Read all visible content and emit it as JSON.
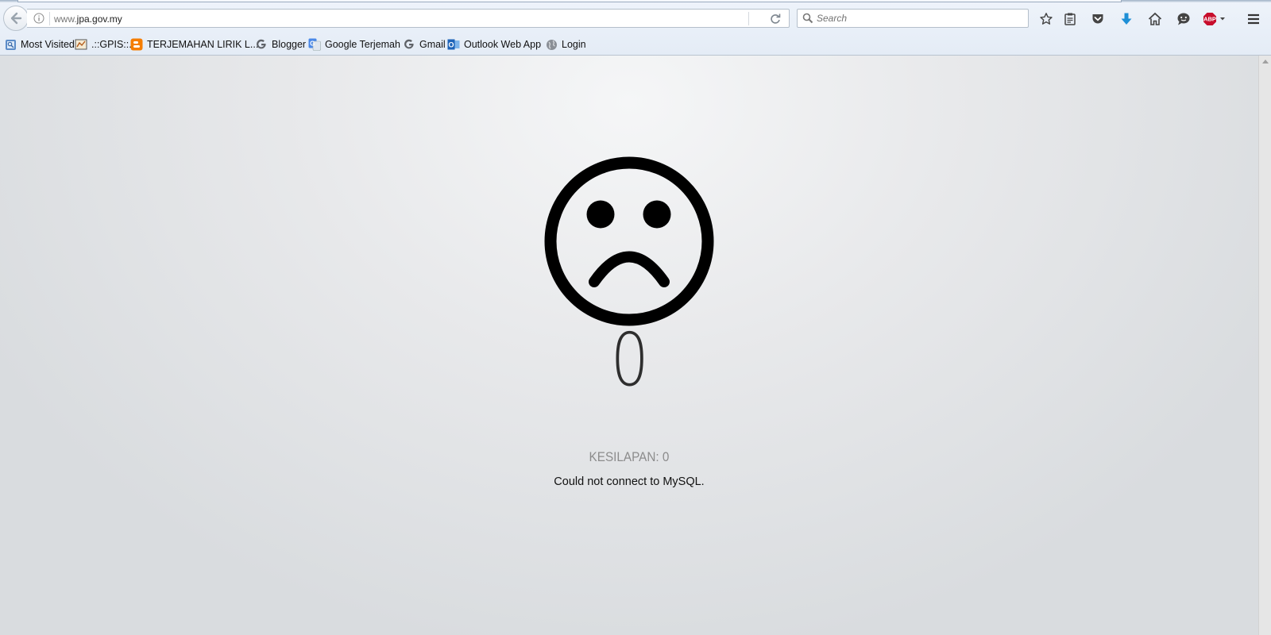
{
  "browser": {
    "url_prefix": "www.",
    "url_domain": "jpa.gov.my",
    "search_placeholder": "Search",
    "bookmarks": [
      {
        "label": "Most Visited",
        "icon": "most-visited-icon"
      },
      {
        "label": ".::GPIS::.",
        "icon": "gpis-favicon"
      },
      {
        "label": "TERJEMAHAN LIRIK L...",
        "icon": "blogger-favicon"
      },
      {
        "label": "Blogger",
        "icon": "google-favicon"
      },
      {
        "label": "Google Terjemah",
        "icon": "google-translate-favicon"
      },
      {
        "label": "Gmail",
        "icon": "google-favicon"
      },
      {
        "label": "Outlook Web App",
        "icon": "outlook-favicon"
      },
      {
        "label": "Login",
        "icon": "globe-favicon"
      }
    ],
    "toolbar_icons": [
      "bookmark-star-icon",
      "reading-list-icon",
      "pocket-icon",
      "download-icon",
      "home-icon",
      "chat-icon",
      "adblock-plus-icon",
      "menu-icon"
    ],
    "adblock_label": "ABP"
  },
  "error_page": {
    "code": "0",
    "label": "KESILAPAN: 0",
    "message": "Could not connect to MySQL."
  },
  "colors": {
    "download_arrow": "#1e8fd6",
    "adblock_red": "#c70d2c",
    "face": "#000000"
  }
}
